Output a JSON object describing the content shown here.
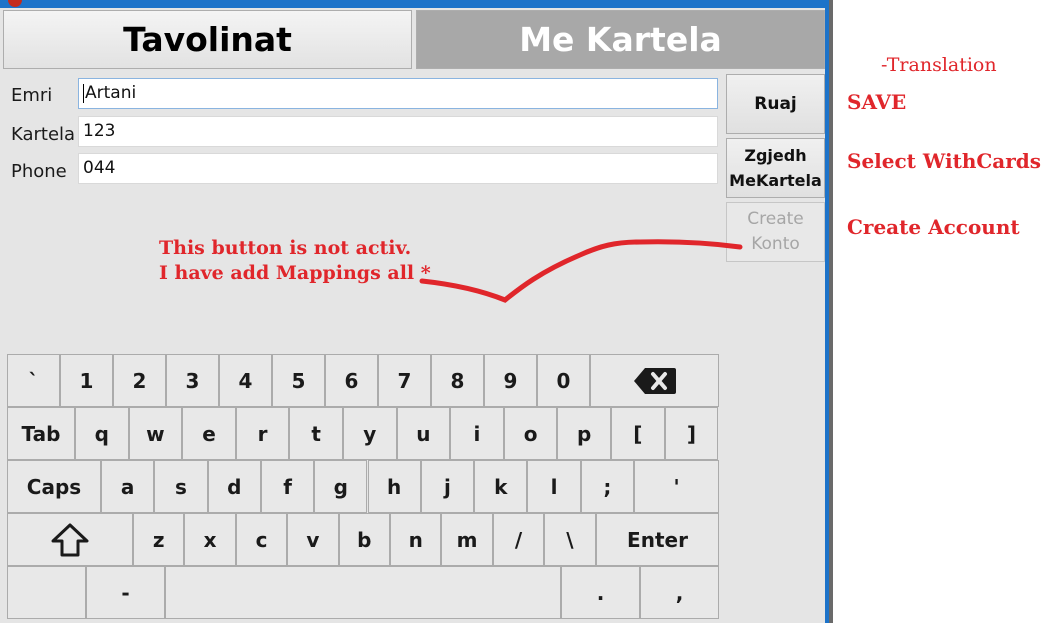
{
  "tabs": {
    "tables": "Tavolinat",
    "with_card": "Me Kartela"
  },
  "form": {
    "name_label": "Emri",
    "name_value": "Artani",
    "card_label": "Kartela",
    "card_value": "123",
    "phone_label": "Phone",
    "phone_value": "044"
  },
  "buttons": {
    "save": "Ruaj",
    "select_line1": "Zgjedh",
    "select_line2": "MeKartela",
    "create_line1": "Create",
    "create_line2": "Konto"
  },
  "annotation": {
    "line1": "This button is not activ.",
    "line2": "I have add Mappings all *"
  },
  "keyboard": {
    "row1": [
      "`",
      "1",
      "2",
      "3",
      "4",
      "5",
      "6",
      "7",
      "8",
      "9",
      "0"
    ],
    "row2": [
      "Tab",
      "q",
      "w",
      "e",
      "r",
      "t",
      "y",
      "u",
      "i",
      "o",
      "p",
      "[",
      "]"
    ],
    "row3": [
      "Caps",
      "a",
      "s",
      "d",
      "f",
      "g",
      "h",
      "j",
      "k",
      "l",
      ";",
      "'"
    ],
    "row4": [
      "z",
      "x",
      "c",
      "v",
      "b",
      "n",
      "m",
      "/",
      "\\",
      "Enter"
    ],
    "row5": [
      "-",
      ".",
      ","
    ]
  },
  "translation": {
    "title": "-Translation",
    "save": "SAVE",
    "select": "Select WithCards",
    "create": "Create Account"
  },
  "colors": {
    "annotation_red": "#e0262b",
    "window_blue": "#1d73c9",
    "active_tab_gray": "#a8a8a8"
  }
}
